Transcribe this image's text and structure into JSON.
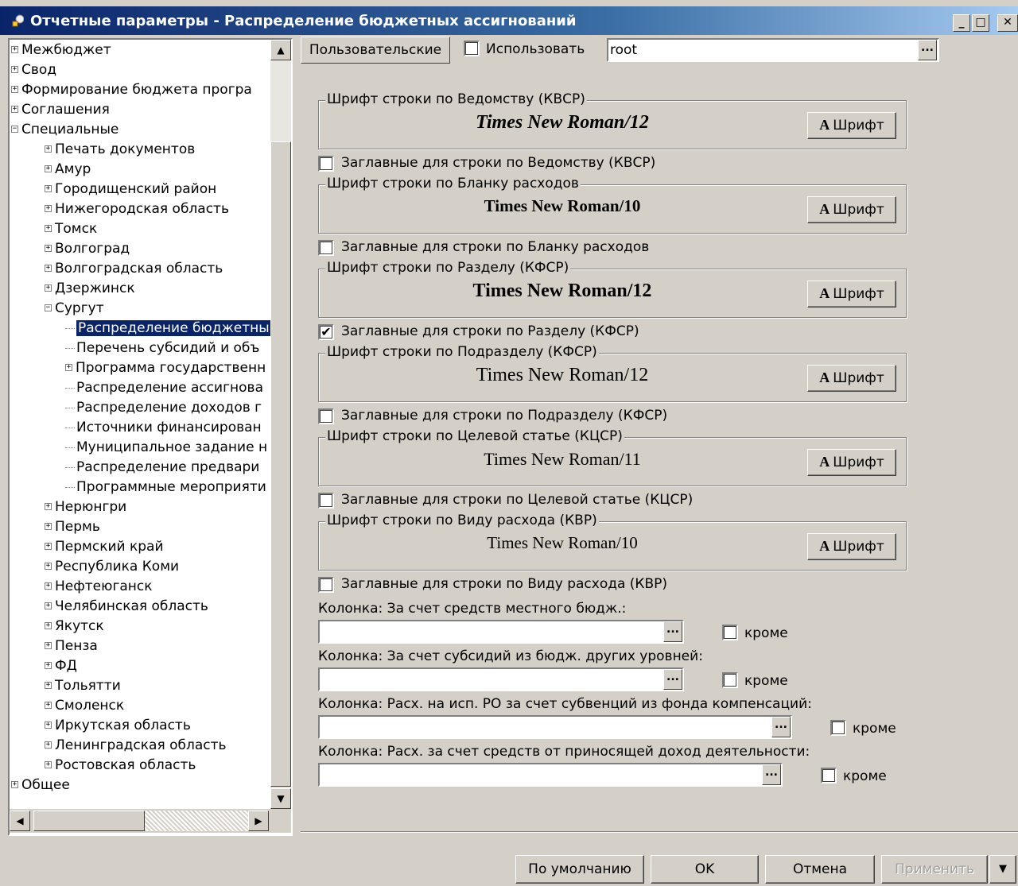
{
  "window": {
    "title": "Отчетные параметры - Распределение бюджетных ассигнований",
    "minimize_label": "_",
    "maximize_label": "□",
    "close_label": "✕"
  },
  "tree": {
    "items": [
      {
        "label": "Межбюджет",
        "expander": "+"
      },
      {
        "label": "Свод",
        "expander": "+"
      },
      {
        "label": "Формирование бюджета програ",
        "expander": "+"
      },
      {
        "label": "Соглашения",
        "expander": "+"
      },
      {
        "label": "Специальные",
        "expander": "−"
      },
      {
        "label": "Печать документов",
        "expander": "+"
      },
      {
        "label": "Амур",
        "expander": "+"
      },
      {
        "label": "Городищенский район",
        "expander": "+"
      },
      {
        "label": "Нижегородская область",
        "expander": "+"
      },
      {
        "label": "Томск",
        "expander": "+"
      },
      {
        "label": "Волгоград",
        "expander": "+"
      },
      {
        "label": "Волгоградская область",
        "expander": "+"
      },
      {
        "label": "Дзержинск",
        "expander": "+"
      },
      {
        "label": "Сургут",
        "expander": "−"
      },
      {
        "label": "Распределение бюджетны",
        "expander": ""
      },
      {
        "label": "Перечень субсидий и объ",
        "expander": ""
      },
      {
        "label": "Программа государственн",
        "expander": "+"
      },
      {
        "label": "Распределение ассигнова",
        "expander": ""
      },
      {
        "label": "Распределение доходов г",
        "expander": ""
      },
      {
        "label": "Источники финансирован",
        "expander": ""
      },
      {
        "label": "Муниципальное задание н",
        "expander": ""
      },
      {
        "label": "Распределение предвари",
        "expander": ""
      },
      {
        "label": "Программные мероприяти",
        "expander": ""
      },
      {
        "label": "Нерюнгри",
        "expander": "+"
      },
      {
        "label": "Пермь",
        "expander": "+"
      },
      {
        "label": "Пермский край",
        "expander": "+"
      },
      {
        "label": "Республика Коми",
        "expander": "+"
      },
      {
        "label": "Нефтеюганск",
        "expander": "+"
      },
      {
        "label": "Челябинская область",
        "expander": "+"
      },
      {
        "label": "Якутск",
        "expander": "+"
      },
      {
        "label": "Пенза",
        "expander": "+"
      },
      {
        "label": "ФД",
        "expander": "+"
      },
      {
        "label": "Тольятти",
        "expander": "+"
      },
      {
        "label": "Смоленск",
        "expander": "+"
      },
      {
        "label": "Иркутская область",
        "expander": "+"
      },
      {
        "label": "Ленинградская область",
        "expander": "+"
      },
      {
        "label": "Ростовская область",
        "expander": "+"
      },
      {
        "label": "Общее",
        "expander": "+"
      }
    ],
    "selected_index": 14
  },
  "top": {
    "preset_button": "Пользовательские",
    "use_label": "Использовать",
    "use_checked": false,
    "profile_value": "root",
    "ellipsis": "..."
  },
  "font_groups": [
    {
      "legend": "Шрифт строки по Ведомству (КВСР)",
      "sample": "Times New Roman/12",
      "button": "Шрифт",
      "caps_label": "Заглавные для строки по Ведомству (КВСР)",
      "caps_checked": false
    },
    {
      "legend": "Шрифт строки по Бланку расходов",
      "sample": "Times New Roman/10",
      "button": "Шрифт",
      "caps_label": "Заглавные для строки по Бланку расходов",
      "caps_checked": false
    },
    {
      "legend": "Шрифт строки по Разделу (КФСР)",
      "sample": "Times New Roman/12",
      "button": "Шрифт",
      "caps_label": "Заглавные для строки по Разделу (КФСР)",
      "caps_checked": true
    },
    {
      "legend": "Шрифт строки по Подразделу (КФСР)",
      "sample": "Times New Roman/12",
      "button": "Шрифт",
      "caps_label": "Заглавные для строки по Подразделу (КФСР)",
      "caps_checked": false
    },
    {
      "legend": "Шрифт строки по Целевой статье (КЦСР)",
      "sample": "Times New Roman/11",
      "button": "Шрифт",
      "caps_label": "Заглавные для строки по Целевой статье (КЦСР)",
      "caps_checked": false
    },
    {
      "legend": "Шрифт строки по Виду расхода (КВР)",
      "sample": "Times New Roman/10",
      "button": "Шрифт",
      "caps_label": "Заглавные для строки по Виду расхода (КВР)",
      "caps_checked": false
    }
  ],
  "columns": [
    {
      "label": "Колонка: За счет средств местного бюдж.:",
      "value": "",
      "except_label": "кроме",
      "except_checked": false
    },
    {
      "label": "Колонка: За счет субсидий из бюдж. других уровней:",
      "value": "",
      "except_label": "кроме",
      "except_checked": false
    },
    {
      "label": "Колонка: Расх. на исп. РО за счет субвенций из фонда компенсаций:",
      "value": "",
      "except_label": "кроме",
      "except_checked": false
    },
    {
      "label": "Колонка: Расх. за счет средств от приносящей доход деятельности:",
      "value": "",
      "except_label": "кроме",
      "except_checked": false
    }
  ],
  "buttons": {
    "default": "По умолчанию",
    "ok": "OK",
    "cancel": "Отмена",
    "apply": "Применить",
    "dropdown": "▼"
  },
  "icons": {
    "app": "report-params-icon",
    "scroll_up": "▲",
    "scroll_down": "▼",
    "scroll_left": "◀",
    "scroll_right": "▶",
    "font_glyph": "A",
    "check_mark": "✔"
  },
  "colors": {
    "title_bar": "#0a246a",
    "selection": "#0a246a",
    "face": "#d4d0c8"
  }
}
